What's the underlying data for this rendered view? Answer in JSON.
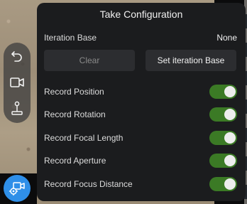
{
  "panel": {
    "title": "Take Configuration",
    "iteration_base": {
      "label": "Iteration Base",
      "value": "None"
    },
    "buttons": {
      "clear": "Clear",
      "set_iteration_base": "Set iteration Base"
    },
    "records": [
      {
        "label": "Record Position",
        "enabled": true
      },
      {
        "label": "Record Rotation",
        "enabled": true
      },
      {
        "label": "Record Focal Length",
        "enabled": true
      },
      {
        "label": "Record Aperture",
        "enabled": true
      },
      {
        "label": "Record Focus Distance",
        "enabled": true
      }
    ]
  },
  "toolbar": {
    "icons": [
      "undo-icon",
      "video-camera-icon",
      "joystick-icon"
    ],
    "camera_button_icon": "camera-settings-icon"
  },
  "colors": {
    "panel_bg": "#1b1c1e",
    "toggle_on": "#3b7a25",
    "accent_blue": "#2f8fe8",
    "button_bg": "#2c2d30"
  }
}
